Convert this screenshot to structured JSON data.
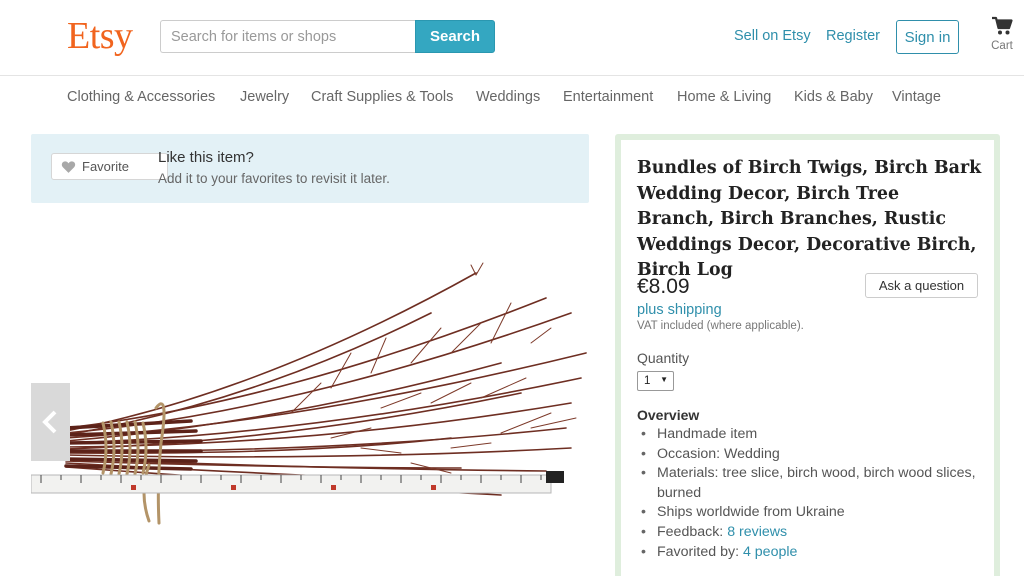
{
  "header": {
    "logo": "Etsy",
    "search_placeholder": "Search for items or shops",
    "search_button": "Search",
    "sell_link": "Sell on Etsy",
    "register_link": "Register",
    "sign_in_button": "Sign in",
    "cart_label": "Cart",
    "accent_color": "#f1641e",
    "link_color": "#2f8fab"
  },
  "nav": {
    "categories": [
      "Clothing & Accessories",
      "Jewelry",
      "Craft Supplies & Tools",
      "Weddings",
      "Entertainment",
      "Home & Living",
      "Kids & Baby",
      "Vintage"
    ]
  },
  "favorite": {
    "button_label": "Favorite",
    "title": "Like this item?",
    "subtitle": "Add it to your favorites to revisit it later."
  },
  "listing": {
    "title": "Bundles of Birch Twigs, Birch Bark Wedding Decor, Birch Tree Branch, Birch Branches, Rustic Weddings Decor, Decorative Birch, Birch Log",
    "price": "€8.09",
    "ask_button": "Ask a question",
    "shipping_link": "plus shipping",
    "vat_note": "VAT included (where applicable).",
    "quantity_label": "Quantity",
    "quantity_value": "1",
    "overview_title": "Overview",
    "overview": {
      "handmade": "Handmade item",
      "occasion": "Occasion: Wedding",
      "materials": "Materials: tree slice, birch wood, birch wood slices, burned",
      "ships": "Ships worldwide from Ukraine",
      "feedback_label": "Feedback: ",
      "feedback_link": "8 reviews",
      "favorited_label": "Favorited by: ",
      "favorited_link": "4 people"
    }
  },
  "icons": {
    "cart": "cart-icon",
    "heart": "heart-icon",
    "prev": "chevron-left-icon"
  }
}
